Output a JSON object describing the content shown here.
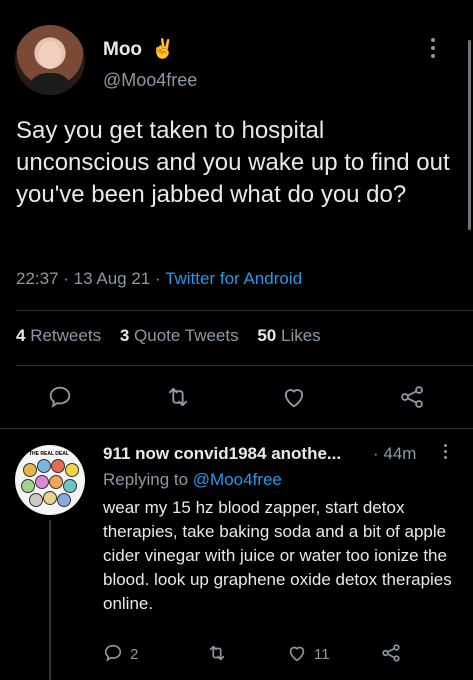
{
  "tweet": {
    "author_name": "Moo",
    "author_emoji": "✌",
    "author_handle": "@Moo4free",
    "text": "Say you get taken to hospital unconscious and you wake up to find out you've been jabbed what do you do?",
    "time": "22:37",
    "date": "13 Aug 21",
    "source": "Twitter for Android",
    "stats": {
      "retweets_count": "4",
      "retweets_label": "Retweets",
      "quotes_count": "3",
      "quotes_label": "Quote Tweets",
      "likes_count": "50",
      "likes_label": "Likes"
    },
    "actions": [
      "reply-icon",
      "retweet-icon",
      "like-icon",
      "share-icon"
    ]
  },
  "reply": {
    "author_name": "911 now convid1984 anothe...",
    "time": "44m",
    "replying_prefix": "Replying to",
    "replying_to": "@Moo4free",
    "text": "wear my 15 hz blood zapper, start detox therapies, take baking soda and a bit of apple cider vinegar with juice or water too ionize the blood. look up graphene oxide detox therapies online.",
    "reply_count": "2",
    "like_count": "11",
    "avatar_caption": "THE REAL DEAL"
  },
  "colors": {
    "background": "#000000",
    "text": "#e7e9ea",
    "muted": "#8b98a5",
    "accent": "#1d9bf0",
    "divider": "#2f3336"
  }
}
